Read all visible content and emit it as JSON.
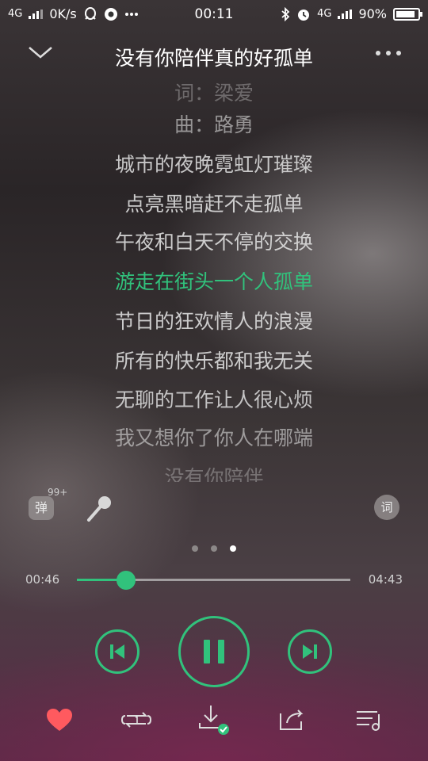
{
  "status_bar": {
    "network_left": "4G",
    "speed": "0K/s",
    "time": "00:11",
    "network_right": "4G",
    "battery": "90%",
    "battery_level": 0.9,
    "icons": [
      "signal-icon",
      "qq-icon",
      "browser-icon",
      "more-icon",
      "bluetooth-icon",
      "alarm-icon",
      "battery-charging-icon"
    ]
  },
  "header": {
    "title": "没有你陪伴真的好孤单",
    "back_icon": "chevron-down-icon",
    "more_icon": "more-dots-icon"
  },
  "lyrics": {
    "lines": [
      "词：梁爱",
      "曲：路勇",
      "城市的夜晚霓虹灯璀璨",
      "点亮黑暗赶不走孤单",
      "午夜和白天不停的交换",
      "游走在街头一个人孤单",
      "节日的狂欢情人的浪漫",
      "所有的快乐都和我无关",
      "无聊的工作让人很心烦",
      "我又想你了你人在哪端",
      "没有你陪伴"
    ],
    "current_index": 5
  },
  "tools": {
    "danmu_label": "弹",
    "danmu_badge": "99+",
    "lyric_search_label": "词"
  },
  "pager": {
    "count": 3,
    "active": 2
  },
  "progress": {
    "current": "00:46",
    "duration": "04:43",
    "played_fraction": 0.18
  },
  "colors": {
    "accent": "#31c27c",
    "heart": "#ff5a5f"
  }
}
